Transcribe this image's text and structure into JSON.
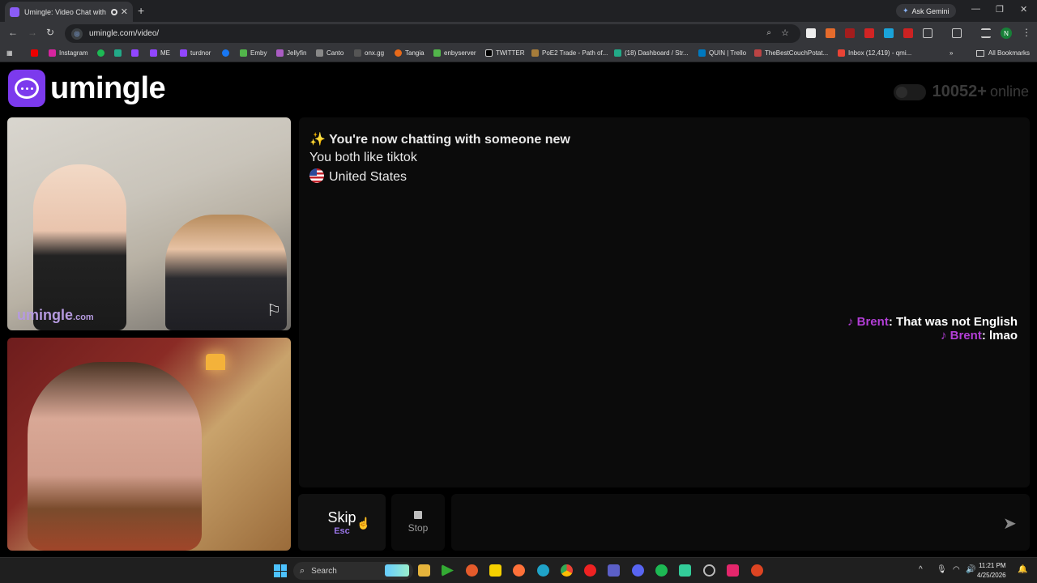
{
  "browser": {
    "tab_title": "Umingle: Video Chat with S",
    "new_tab": "+",
    "ask_gemini": "Ask Gemini",
    "url": "umingle.com/video/",
    "profile_initial": "N",
    "bookmarks": [
      "Instagram",
      "ME",
      "turdnor",
      "Emby",
      "Jellyfin",
      "Canto",
      "onx.gg",
      "Tangia",
      "enbyserver",
      "TWITTER",
      "PoE2 Trade - Path of...",
      "(18) Dashboard / Str...",
      "QUIN | Trello",
      "TheBestCouchPotat...",
      "Inbox (12,419) - qmi..."
    ],
    "all_bookmarks": "All Bookmarks"
  },
  "header": {
    "logo_text": "umingle",
    "online_count": "10052+",
    "online_label": "online"
  },
  "video": {
    "watermark_main": "umingle",
    "watermark_suffix": ".com"
  },
  "chat": {
    "intro_icon": "✨",
    "intro": "You're now chatting with someone new",
    "interests": "You both like tiktok",
    "country": "United States",
    "messages": [
      {
        "platform_icon": "tiktok-icon",
        "name": "Brent",
        "sep": ":",
        "text": "That was not English"
      },
      {
        "platform_icon": "tiktok-icon",
        "name": "Brent",
        "sep": ":",
        "text": "lmao"
      }
    ]
  },
  "controls": {
    "skip_label": "Skip",
    "skip_key": "Esc",
    "stop_label": "Stop",
    "message_placeholder": ""
  },
  "taskbar": {
    "search_label": "Search",
    "time": "11:21 PM",
    "date": "4/25/2026"
  },
  "colors": {
    "brand_purple": "#7c3aed",
    "chat_name": "#b23ed6",
    "accent_key": "#9a76e8"
  }
}
